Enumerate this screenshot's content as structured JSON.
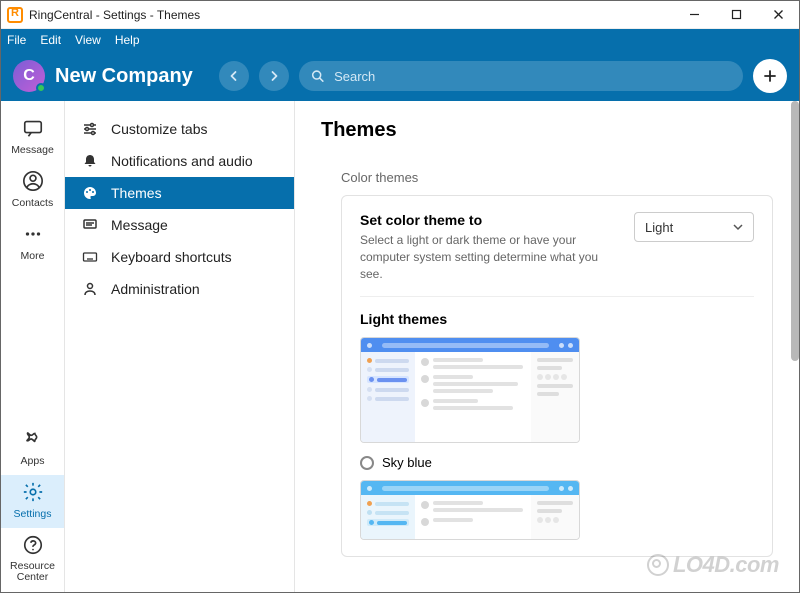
{
  "window": {
    "title": "RingCentral - Settings - Themes"
  },
  "menubar": [
    "File",
    "Edit",
    "View",
    "Help"
  ],
  "header": {
    "avatar_letter": "C",
    "company": "New Company",
    "search_placeholder": "Search"
  },
  "leftrail": {
    "top": [
      {
        "key": "message",
        "label": "Message"
      },
      {
        "key": "contacts",
        "label": "Contacts"
      },
      {
        "key": "more",
        "label": "More"
      }
    ],
    "bottom": [
      {
        "key": "apps",
        "label": "Apps"
      },
      {
        "key": "settings",
        "label": "Settings",
        "active": true
      },
      {
        "key": "resource",
        "label": "Resource Center"
      }
    ]
  },
  "subnav": [
    {
      "key": "customize",
      "icon": "sliders",
      "label": "Customize tabs"
    },
    {
      "key": "notifications",
      "icon": "bell",
      "label": "Notifications and audio"
    },
    {
      "key": "themes",
      "icon": "palette",
      "label": "Themes",
      "active": true
    },
    {
      "key": "msg",
      "icon": "message",
      "label": "Message"
    },
    {
      "key": "keyboard",
      "icon": "keyboard",
      "label": "Keyboard shortcuts"
    },
    {
      "key": "admin",
      "icon": "admin",
      "label": "Administration"
    }
  ],
  "content": {
    "page_title": "Themes",
    "section_label": "Color themes",
    "option": {
      "title": "Set color theme to",
      "description": "Select a light or dark theme or have your computer system setting determine what you see.",
      "selected": "Light"
    },
    "light_section_title": "Light themes",
    "theme_option_label": "Sky blue"
  },
  "watermark": "LO4D.com"
}
